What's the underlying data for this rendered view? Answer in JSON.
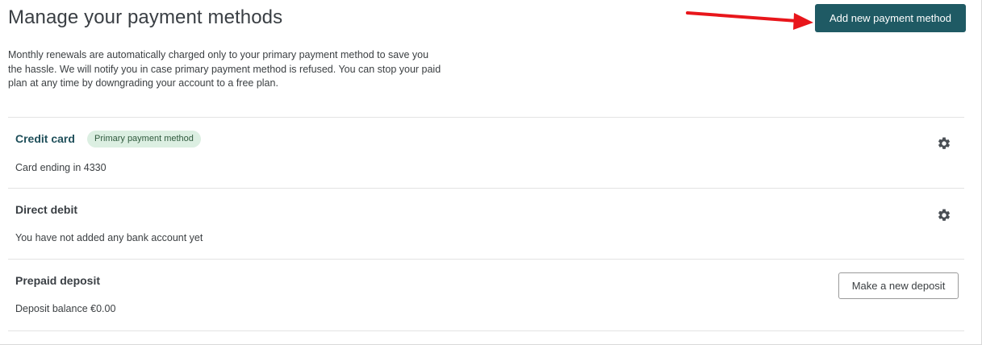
{
  "header": {
    "title": "Manage your payment methods",
    "add_button_label": "Add new payment method",
    "annotation_arrow_color": "#e8161b"
  },
  "description": "Monthly renewals are automatically charged only to your primary payment method to save you the hassle. We will notify you in case primary payment method is refused. You can stop your paid plan at any time by downgrading your account to a free plan.",
  "methods": [
    {
      "name": "Credit card",
      "badge": "Primary payment method",
      "detail": "Card ending in 4330",
      "action_icon": "gear-icon"
    },
    {
      "name": "Direct debit",
      "detail": "You have not added any bank account yet",
      "action_icon": "gear-icon"
    },
    {
      "name": "Prepaid deposit",
      "detail": "Deposit balance €0.00",
      "action_label": "Make a new deposit"
    }
  ],
  "colors": {
    "primary_button": "#1f5a64",
    "badge_background": "#dcefe2",
    "badge_text": "#2f5a3d"
  }
}
